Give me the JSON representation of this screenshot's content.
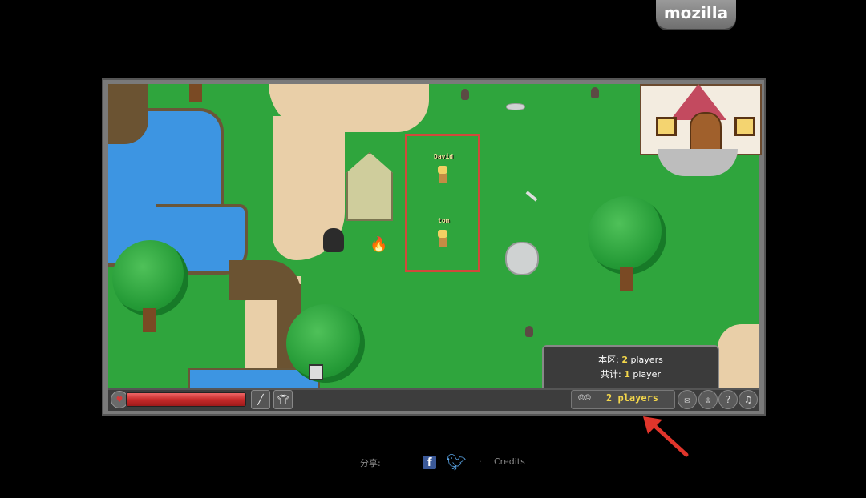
{
  "brand": {
    "tab_label": "mozilla"
  },
  "characters": [
    {
      "name": "David"
    },
    {
      "name": "tom"
    }
  ],
  "hud": {
    "hp_fraction": 1.0,
    "weapon_icon": "sword-icon",
    "armor_icon": "armor-icon",
    "population_button": "2 players",
    "population_icon": "players-icon",
    "chat_icon": "chat-icon",
    "achievements_icon": "trophy-icon",
    "help_icon": "help-icon",
    "sound_icon": "speaker-icon"
  },
  "population_popup": {
    "local_label": "本区: ",
    "local_count": "2",
    "local_unit": " players",
    "total_label": "共计: ",
    "total_count": "1",
    "total_unit": " player"
  },
  "footer": {
    "share_label": "分享:",
    "separator": "·",
    "credits": "Credits"
  },
  "colors": {
    "grass": "#2fa53d",
    "water": "#3d95e2",
    "highlight_box": "#d1493b",
    "population_text": "#f3d64b",
    "arrow": "#e0352b"
  }
}
